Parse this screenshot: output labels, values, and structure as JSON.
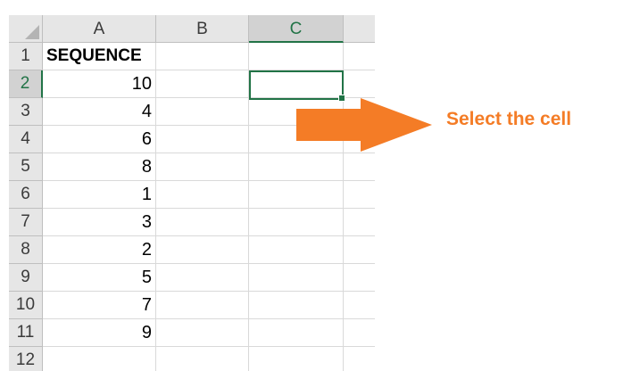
{
  "spreadsheet": {
    "columns": [
      {
        "letter": "A",
        "active": false
      },
      {
        "letter": "B",
        "active": false
      },
      {
        "letter": "C",
        "active": true
      }
    ],
    "rows": [
      {
        "number": "1",
        "active": false,
        "a": "SEQUENCE",
        "a_bold": true
      },
      {
        "number": "2",
        "active": true,
        "a": "10"
      },
      {
        "number": "3",
        "active": false,
        "a": "4"
      },
      {
        "number": "4",
        "active": false,
        "a": "6"
      },
      {
        "number": "5",
        "active": false,
        "a": "8"
      },
      {
        "number": "6",
        "active": false,
        "a": "1"
      },
      {
        "number": "7",
        "active": false,
        "a": "3"
      },
      {
        "number": "8",
        "active": false,
        "a": "2"
      },
      {
        "number": "9",
        "active": false,
        "a": "5"
      },
      {
        "number": "10",
        "active": false,
        "a": "7"
      },
      {
        "number": "11",
        "active": false,
        "a": "9"
      },
      {
        "number": "12",
        "active": false,
        "a": ""
      }
    ],
    "selected_cell": "C2"
  },
  "annotation": {
    "text": "Select the cell",
    "color": "#f47c26"
  },
  "colors": {
    "accent": "#217346",
    "header_bg": "#e6e6e6",
    "header_active_bg": "#d2d2d2",
    "grid": "#d9d9d9",
    "arrow": "#f47c26"
  }
}
